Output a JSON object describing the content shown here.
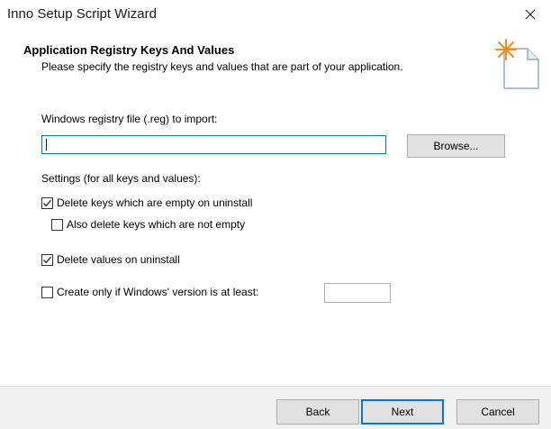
{
  "window": {
    "title": "Inno Setup Script Wizard"
  },
  "header": {
    "title": "Application Registry Keys And Values",
    "subtitle": "Please specify the registry keys and values that are part of your application."
  },
  "registry": {
    "label": "Windows registry file (.reg) to import:",
    "value": "",
    "browse_label": "Browse..."
  },
  "settings": {
    "label": "Settings (for all keys and values):",
    "delete_empty_keys": {
      "label": "Delete keys which are empty on uninstall",
      "checked": true
    },
    "delete_nonempty_keys": {
      "label": "Also delete keys which are not empty",
      "checked": false
    },
    "delete_values": {
      "label": "Delete values on uninstall",
      "checked": true
    },
    "min_version": {
      "label": "Create only if Windows' version is at least:",
      "checked": false,
      "value": ""
    }
  },
  "footer": {
    "back_label": "Back",
    "next_label": "Next",
    "cancel_label": "Cancel"
  }
}
